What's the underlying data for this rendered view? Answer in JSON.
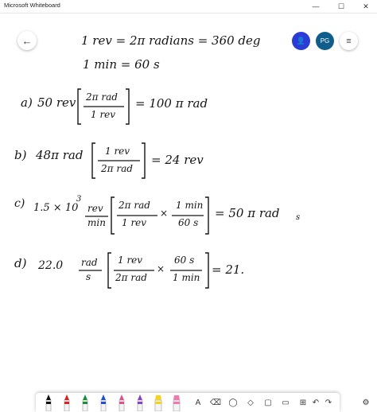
{
  "window": {
    "title": "Microsoft Whiteboard",
    "minimize_glyph": "—",
    "maximize_glyph": "☐",
    "close_glyph": "✕"
  },
  "top_controls": {
    "back_glyph": "←",
    "invite_glyph": "👤",
    "avatar_initials": "PG",
    "menu_glyph": "≡",
    "invite_color": "#2b3bd6",
    "avatar_color": "#0f5d8a"
  },
  "ink": {
    "line1": "1 rev = 2π radians = 360 deg",
    "line2": "1 min = 60 s",
    "a_label": "a)",
    "a_value": "50 rev",
    "a_num": "2π rad",
    "a_den": "1 rev",
    "a_result": "= 100 π rad",
    "b_label": "b)",
    "b_value": "48π rad",
    "b_num": "1 rev",
    "b_den": "2π rad",
    "b_result": "= 24 rev",
    "c_label": "c)",
    "c_value": "1.5 × 10",
    "c_exp": "3",
    "c_unit_num": "rev",
    "c_unit_den": "min",
    "c_f1_num": "2π rad",
    "c_f1_den": "1 rev",
    "c_times": "×",
    "c_f2_num": "1 min",
    "c_f2_den": "60 s",
    "c_result": "= 50 π rad",
    "c_result_unit": "s",
    "d_label": "d)",
    "d_value": "22.0",
    "d_unit_num": "rad",
    "d_unit_den": "s",
    "d_f1_num": "1 rev",
    "d_f1_den": "2π rad",
    "d_times": "×",
    "d_f2_num": "60 s",
    "d_f2_den": "1 min",
    "d_result": "= 21."
  },
  "toolbar": {
    "tools": [
      {
        "name": "pen-black",
        "color": "#111111"
      },
      {
        "name": "pen-red",
        "color": "#e02020"
      },
      {
        "name": "pen-green",
        "color": "#1a8f3a"
      },
      {
        "name": "pen-blue",
        "color": "#1f4fd8"
      },
      {
        "name": "pen-pink",
        "color": "#e0508a"
      },
      {
        "name": "pen-purple",
        "color": "#8a3fc8"
      },
      {
        "name": "highlighter-yellow",
        "color": "#f5d31a"
      },
      {
        "name": "highlighter-pink",
        "color": "#f07ab0"
      }
    ],
    "text_glyph": "A",
    "eraser_glyph": "⌫",
    "lasso_glyph": "◯",
    "ruler_glyph": "◇",
    "note_glyph": "▢",
    "image_glyph": "▭",
    "add_glyph": "⊞",
    "undo_glyph": "↶",
    "redo_glyph": "↷",
    "settings_glyph": "⚙"
  }
}
